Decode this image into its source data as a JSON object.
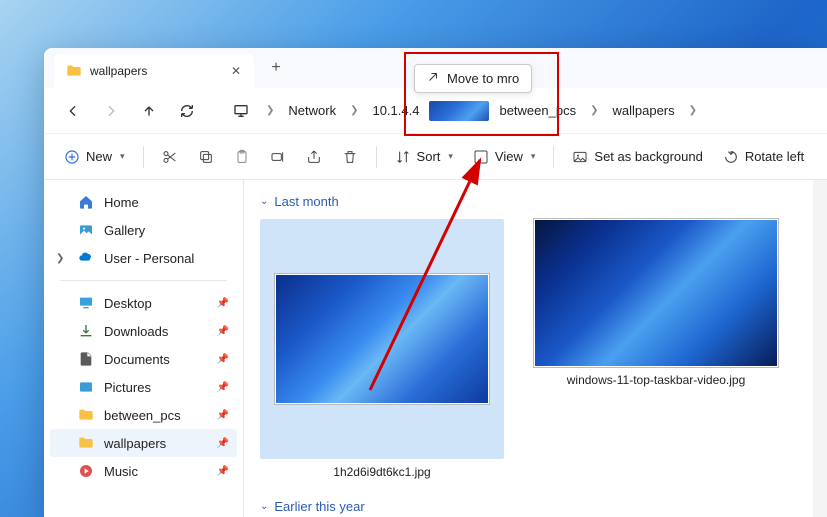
{
  "tab": {
    "title": "wallpapers"
  },
  "drag_tooltip": "Move to mro",
  "breadcrumb": {
    "items": [
      "Network",
      "10.1.4.4",
      "between_pcs",
      "wallpapers"
    ]
  },
  "toolbar": {
    "new": "New",
    "sort": "Sort",
    "view": "View",
    "set_bg": "Set as background",
    "rotate_left": "Rotate left"
  },
  "sidebar": {
    "home": "Home",
    "gallery": "Gallery",
    "user": "User - Personal",
    "desktop": "Desktop",
    "downloads": "Downloads",
    "documents": "Documents",
    "pictures": "Pictures",
    "between_pcs": "between_pcs",
    "wallpapers": "wallpapers",
    "music": "Music"
  },
  "content": {
    "group1": "Last month",
    "group2": "Earlier this year",
    "file1": "1h2d6i9dt6kc1.jpg",
    "file2": "windows-11-top-taskbar-video.jpg"
  }
}
